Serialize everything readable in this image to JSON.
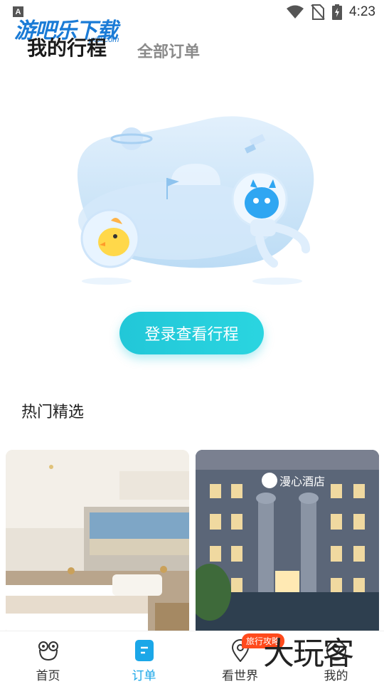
{
  "status_bar": {
    "time": "4:23",
    "indicator_letter": "A"
  },
  "watermark": {
    "text": "游吧乐下载",
    "sub": "yxbl.com"
  },
  "header": {
    "tab_mine": "我的行程",
    "tab_all": "全部订单"
  },
  "login_button": {
    "label": "登录查看行程"
  },
  "section": {
    "title": "热门精选"
  },
  "cards": [
    {
      "kind": "hotel-room-photo"
    },
    {
      "kind": "hotel-facade-photo",
      "sign_text": "漫心酒店"
    }
  ],
  "bottom_nav": {
    "items": [
      {
        "label": "首页",
        "icon": "frog-home-icon",
        "active": false
      },
      {
        "label": "订单",
        "icon": "order-doc-icon",
        "active": true
      },
      {
        "label": "看世界",
        "icon": "location-pin-icon",
        "active": false,
        "badge": "旅行攻略"
      },
      {
        "label": "我的",
        "icon": "profile-icon",
        "active": false
      }
    ]
  },
  "watermark2": {
    "text": "大玩客"
  },
  "colors": {
    "accent": "#22c7d8",
    "nav_active": "#1ba7e8",
    "badge": "#ff4a1c"
  }
}
